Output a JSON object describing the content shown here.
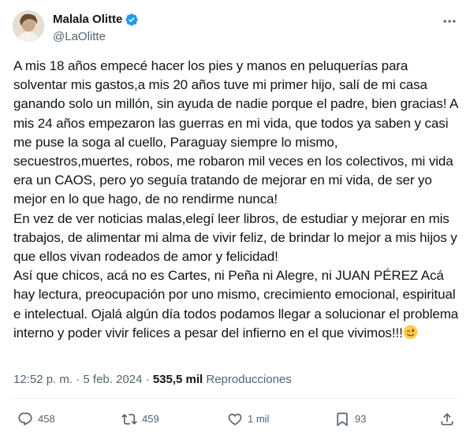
{
  "author": {
    "display_name": "Malala Olitte",
    "handle": "@LaOlitte",
    "verified": true
  },
  "tweet": {
    "text": "A mis 18 años empecé hacer los pies y manos en peluquerías para solventar mis gastos,a mis 20 años tuve mi primer hijo, salí de mi casa ganando solo un millón, sin ayuda de nadie porque el padre, bien gracias! A mis 24 años empezaron las guerras en mi vida, que todos ya saben y casi me puse la soga al cuello, Paraguay siempre lo mismo, secuestros,muertes, robos, me robaron mil veces en los colectivos, mi vida era un CAOS, pero yo seguía tratando de mejorar en mi vida, de ser yo mejor en lo que hago, de no rendirme nunca!\nEn vez de ver noticias malas,elegí leer libros, de estudiar y mejorar en mis trabajos, de alimentar mi alma de vivir feliz, de brindar lo mejor a mis hijos y que ellos vivan rodeados de amor y felicidad!\nAsí que chicos, acá no es Cartes, ni Peña ni Alegre, ni JUAN PÉREZ Acá hay lectura, preocupación por uno mismo, crecimiento emocional, espiritual e intelectual. Ojalá algún día todos podamos llegar a solucionar el problema interno y poder vivir felices a pesar del infierno en el que vivimos!!!",
    "emoji": "winking-face"
  },
  "meta": {
    "time": "12:52 p. m.",
    "separator": "·",
    "date": "5 feb. 2024",
    "views_count": "535,5 mil",
    "views_label": "Reproducciones"
  },
  "actions": {
    "replies": "458",
    "reposts": "459",
    "likes": "1 mil",
    "bookmarks": "93"
  },
  "colors": {
    "text": "#0f1419",
    "secondary": "#536471",
    "verified": "#1d9bf0",
    "divider": "#eff3f4"
  }
}
